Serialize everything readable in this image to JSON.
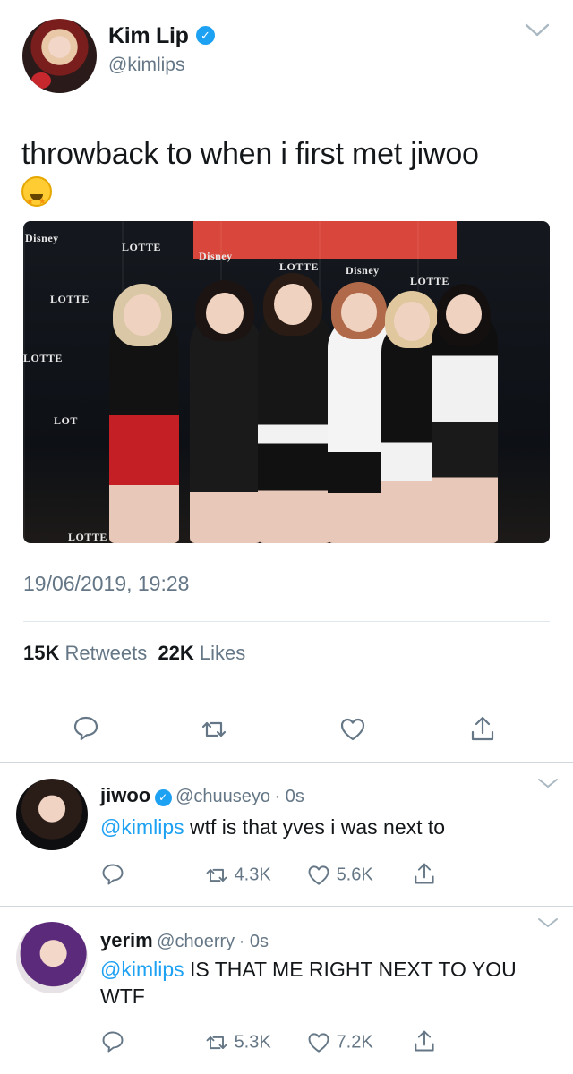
{
  "tweet": {
    "author_name": "Kim Lip",
    "author_handle": "@kimlips",
    "text": "throwback to when i first met jiwoo",
    "timestamp": "19/06/2019, 19:28",
    "retweets_count": "15K",
    "retweets_label": "Retweets",
    "likes_count": "22K",
    "likes_label": "Likes",
    "photo_signage": [
      "LOTTE",
      "Disney",
      "LOTTE",
      "Disney",
      "LOTTE",
      "LOTTE",
      "Disney",
      "LOTTE",
      "LOT",
      "LOTTE"
    ]
  },
  "replies": [
    {
      "name": "jiwoo",
      "handle": "@chuuseyo",
      "time": "· 0s",
      "mention": "@kimlips",
      "text": " wtf is that yves i was next to",
      "retweets": "4.3K",
      "likes": "5.6K"
    },
    {
      "name": "yerim",
      "handle": "@choerry",
      "time": "· 0s",
      "mention": "@kimlips",
      "text": " IS THAT ME RIGHT NEXT TO YOU WTF",
      "retweets": "5.3K",
      "likes": "7.2K"
    }
  ],
  "colors": {
    "link": "#1da1f2",
    "muted": "#657786",
    "text": "#14171a"
  }
}
